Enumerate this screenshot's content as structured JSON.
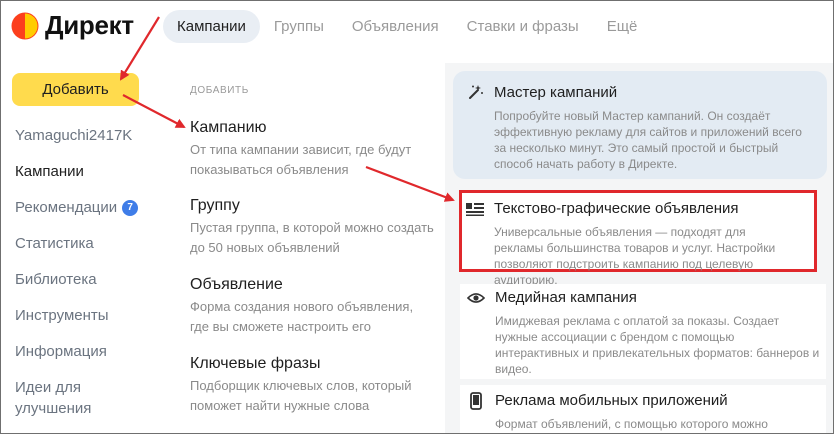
{
  "app": {
    "logo_text": "Директ"
  },
  "nav": {
    "items": [
      "Кампании",
      "Группы",
      "Объявления",
      "Ставки и фразы",
      "Ещё"
    ],
    "active_index": 0
  },
  "sidebar": {
    "add_button": "Добавить",
    "items": [
      {
        "label": "Yamaguchi2417K"
      },
      {
        "label": "Кампании"
      },
      {
        "label": "Рекомендации",
        "badge": "7"
      },
      {
        "label": "Статистика"
      },
      {
        "label": "Библиотека"
      },
      {
        "label": "Инструменты"
      },
      {
        "label": "Информация"
      },
      {
        "label": "Идеи для улучшения"
      }
    ]
  },
  "add_menu": {
    "heading": "ДОБАВИТЬ",
    "items": [
      {
        "title": "Кампанию",
        "description": "От типа кампании зависит, где будут показываться объявления"
      },
      {
        "title": "Группу",
        "description": "Пустая группа, в которой можно создать до 50 новых объявлений"
      },
      {
        "title": "Объявление",
        "description": "Форма создания нового объявления, где вы сможете настроить его"
      },
      {
        "title": "Ключевые фразы",
        "description": "Подборщик ключевых слов, который поможет найти нужные слова"
      }
    ]
  },
  "campaign_types": {
    "master": {
      "title": "Мастер кампаний",
      "description": "Попробуйте новый Мастер кампаний. Он создаёт эффективную рекламу для сайтов и приложений всего за несколько минут. Это самый простой и быстрый способ начать работу в Директе."
    },
    "text_graphic": {
      "title": "Текстово-графические объявления",
      "description": "Универсальные объявления — подходят для рекламы большинства товаров и услуг. Настройки позволяют подстроить кампанию под целевую аудиторию."
    },
    "media": {
      "title": "Медийная кампания",
      "description": "Имиджевая реклама с оплатой за показы. Создает нужные ассоциации с брендом с помощью интерактивных и привлекательных форматов: баннеров и видео."
    },
    "mobile": {
      "title": "Реклама мобильных приложений",
      "description": "Формат объявлений, с помощью которого можно"
    }
  },
  "colors": {
    "accent_yellow": "#ffdb4d",
    "highlight_red": "#e0282c",
    "badge_blue": "#3f7de8",
    "nav_active_bg": "#e9eef4",
    "master_card_bg": "#e3ebf3"
  },
  "icons": {
    "logo": "yandex-direct-logo",
    "master": "magic-wand-icon",
    "text_graphic": "text-image-icon",
    "media": "eye-icon",
    "mobile": "smartphone-icon"
  }
}
